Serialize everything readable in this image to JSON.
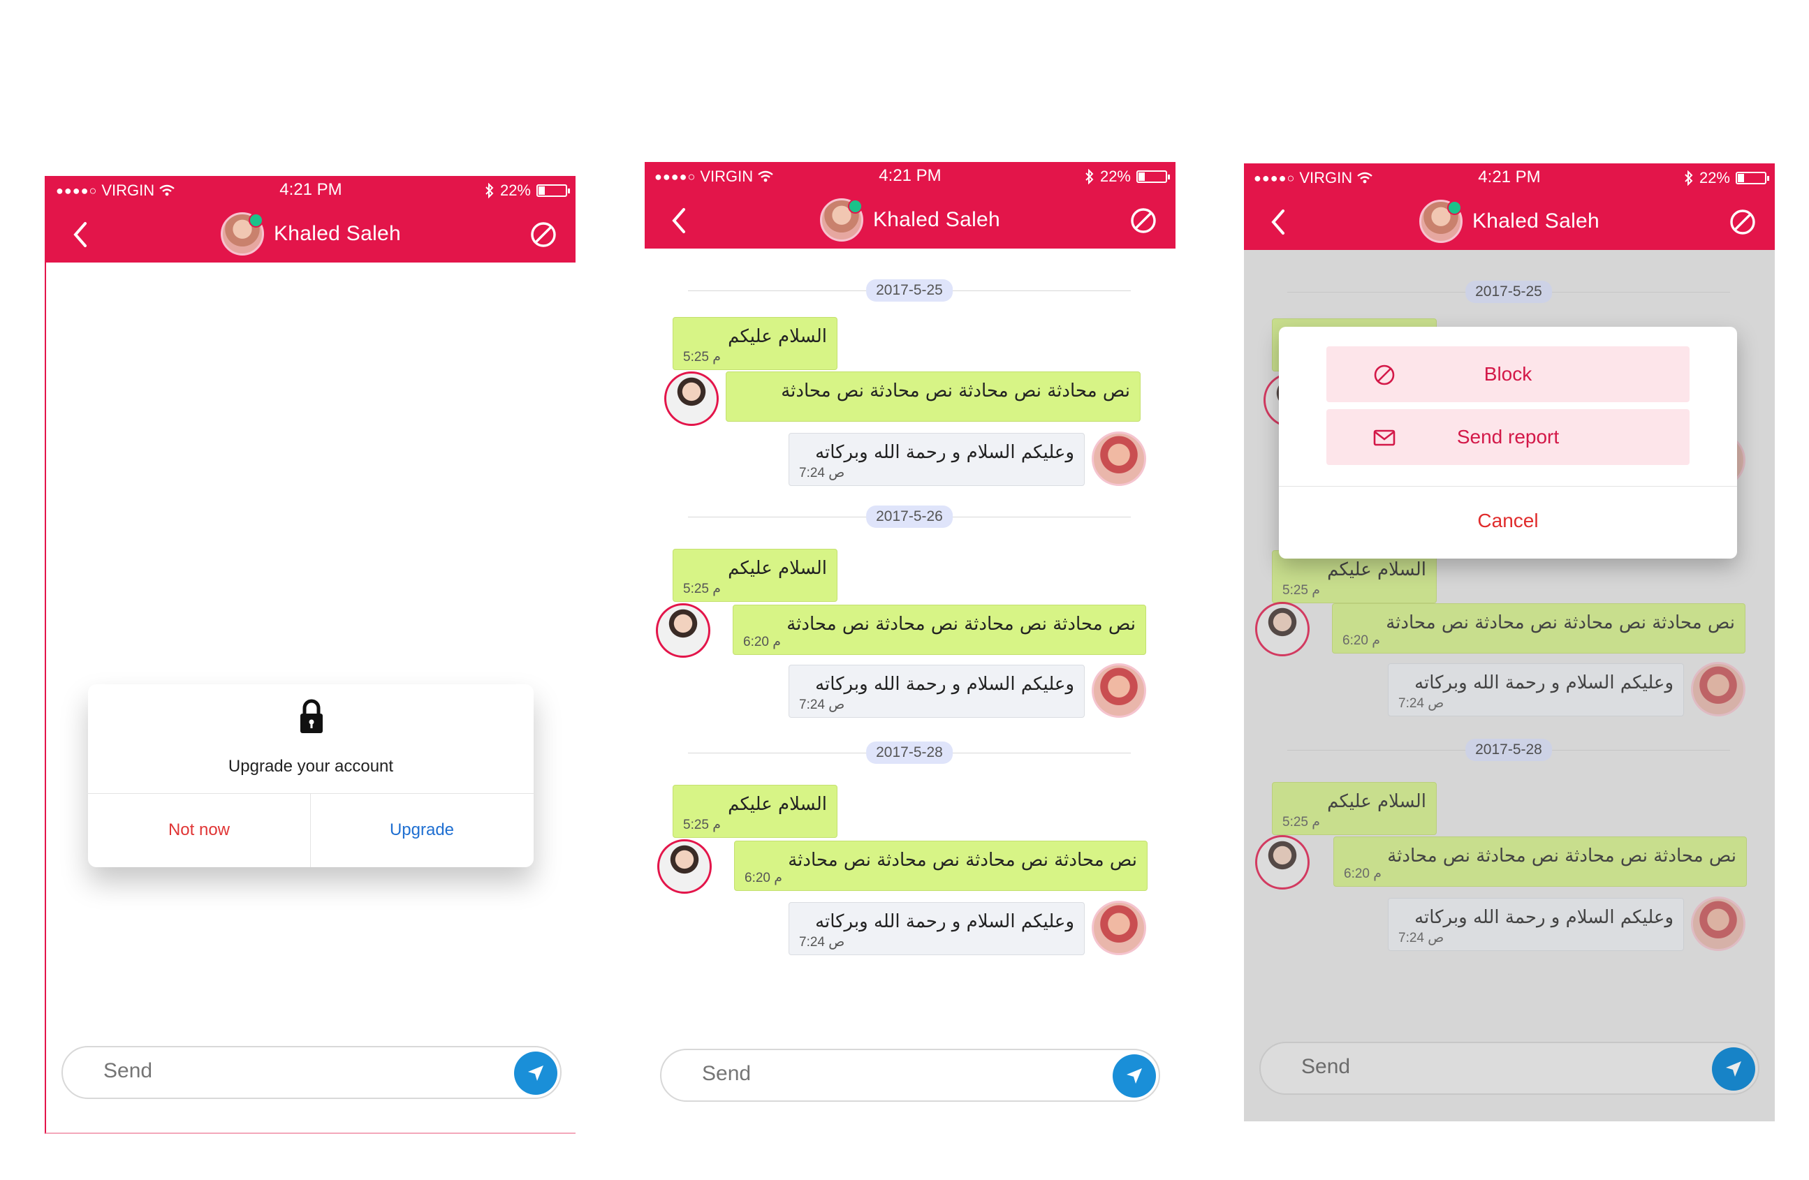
{
  "status": {
    "carrier": "VIRGIN",
    "signal_dots": "●●●●○",
    "time": "4:21 PM",
    "battery": "22%",
    "battery_level": 0.22
  },
  "header": {
    "contact_name": "Khaled Saleh",
    "back_icon": "chevron-left-icon",
    "block_icon": "block-icon",
    "online": true
  },
  "input": {
    "placeholder": "Send"
  },
  "colors": {
    "brand": "#e3154a",
    "online": "#1bc28a",
    "send_button": "#1a8fd8",
    "bubble_sent": "#d7f486",
    "bubble_received": "#f0f2f6",
    "date_pill": "#dfe4fa"
  },
  "upgrade_dialog": {
    "title": "Upgrade your account",
    "not_now": "Not now",
    "upgrade": "Upgrade",
    "icon": "lock-icon"
  },
  "conversation": {
    "groups": [
      {
        "date": "2017-5-25",
        "greeting": {
          "text": "السلام عليكم",
          "time": "5:25 م"
        },
        "long": {
          "text": "نص محادثة نص محادثة نص محادثة نص محادثة",
          "time": ""
        },
        "reply": {
          "text": "وعليكم السلام و رحمة الله وبركاته",
          "time": "7:24 ص"
        }
      },
      {
        "date": "2017-5-26",
        "greeting": {
          "text": "السلام عليكم",
          "time": "5:25 م"
        },
        "long": {
          "text": "نص محادثة نص محادثة نص محادثة نص محادثة",
          "time": "6:20 م"
        },
        "reply": {
          "text": "وعليكم السلام و رحمة الله وبركاته",
          "time": "7:24 ص"
        }
      },
      {
        "date": "2017-5-28",
        "greeting": {
          "text": "السلام عليكم",
          "time": "5:25 م"
        },
        "long": {
          "text": "نص محادثة نص محادثة نص محادثة نص محادثة",
          "time": "6:20 م"
        },
        "reply": {
          "text": "وعليكم السلام و رحمة الله وبركاته",
          "time": "7:24 ص"
        }
      }
    ]
  },
  "action_sheet": {
    "block": "Block",
    "send_report": "Send report",
    "cancel": "Cancel"
  }
}
